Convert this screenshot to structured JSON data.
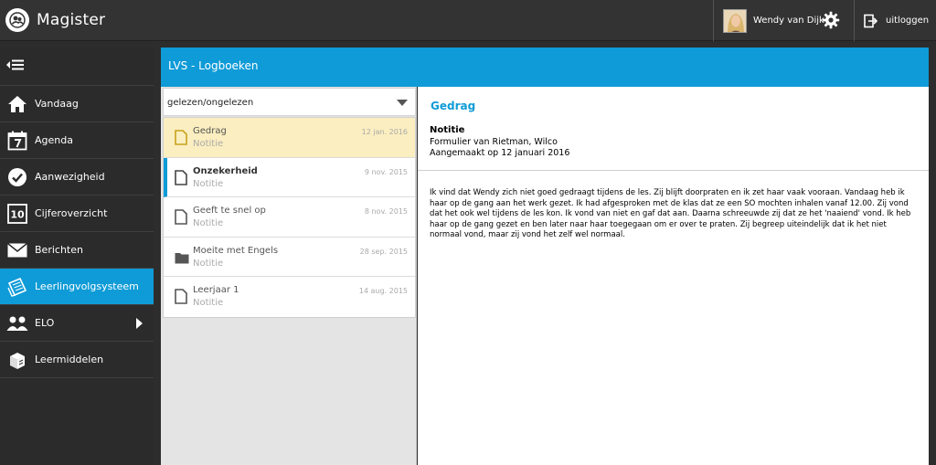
{
  "app": {
    "name": "Magister"
  },
  "user": {
    "name": "Wendy van Dijk",
    "settings_icon": "gear-icon",
    "logout_label": "uitloggen"
  },
  "sidebar": {
    "items": [
      {
        "label": "Vandaag",
        "icon": "home-icon"
      },
      {
        "label": "Agenda",
        "icon": "calendar-icon"
      },
      {
        "label": "Aanwezigheid",
        "icon": "check-icon"
      },
      {
        "label": "Cijferoverzicht",
        "icon": "grades-icon"
      },
      {
        "label": "Berichten",
        "icon": "envelope-icon"
      },
      {
        "label": "Leerlingvolgsysteem",
        "icon": "notebook-icon",
        "active": true
      },
      {
        "label": "ELO",
        "icon": "group-icon",
        "has_submenu": true
      },
      {
        "label": "Leermiddelen",
        "icon": "books-icon"
      }
    ]
  },
  "main": {
    "title": "LVS - Logboeken",
    "filter": {
      "selected": "gelezen/ongelezen"
    },
    "entries": [
      {
        "title": "Gedrag",
        "type": "Notitie",
        "date": "12 jan. 2016",
        "icon": "document-icon",
        "state": "selected"
      },
      {
        "title": "Onzekerheid",
        "type": "Notitie",
        "date": "9 nov. 2015",
        "icon": "document-icon",
        "state": "unread"
      },
      {
        "title": "Geeft te snel op",
        "type": "Notitie",
        "date": "8 nov. 2015",
        "icon": "document-icon",
        "state": "read"
      },
      {
        "title": "Moeite met Engels",
        "type": "Notitie",
        "date": "28 sep. 2015",
        "icon": "folder-icon",
        "state": "read"
      },
      {
        "title": "Leerjaar 1",
        "type": "Notitie",
        "date": "14 aug. 2015",
        "icon": "document-icon",
        "state": "read"
      }
    ],
    "detail": {
      "title": "Gedrag",
      "type": "Notitie",
      "form": "Formulier van Rietman, Wilco",
      "created": "Aangemaakt op 12 januari 2016",
      "body": "Ik vind dat Wendy zich niet goed gedraagt tijdens de les. Zij blijft doorpraten en ik zet haar vaak vooraan. Vandaag heb ik haar op de gang aan het werk gezet. Ik had afgesproken met de klas dat ze een SO mochten inhalen vanaf 12.00. Zij vond dat het ook wel tijdens de les kon. Ik vond van niet en gaf dat aan. Daarna schreeuwde zij dat ze het 'naaiend' vond. Ik heb haar op de gang gezet en ben later naar haar toegegaan om er over te praten. Zij begreep uiteindelijk dat ik het niet normaal vond, maar zij vond het zelf wel normaal."
    }
  },
  "colors": {
    "accent": "#0f9bd7",
    "topbar": "#333333",
    "sidebar": "#2b2b2b",
    "selected_row": "#fbeec0"
  }
}
